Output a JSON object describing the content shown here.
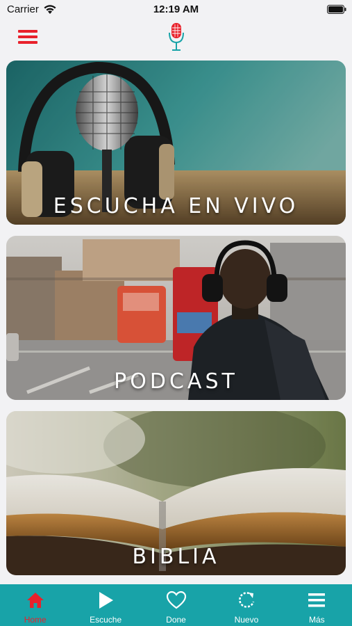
{
  "status_bar": {
    "carrier": "Carrier",
    "time": "12:19 AM"
  },
  "header": {
    "menu_icon": "hamburger-menu-icon",
    "logo_icon": "microphone-logo-icon",
    "accent_color": "#e8212b"
  },
  "cards": [
    {
      "label": "ESCUCHA EN VIVO",
      "image": "microphone-headphones-photo"
    },
    {
      "label": "PODCAST",
      "image": "man-with-headphones-street-photo"
    },
    {
      "label": "BIBLIA",
      "image": "open-bible-photo"
    }
  ],
  "tab_bar": {
    "background": "#18a3a8",
    "tabs": [
      {
        "label": "Home",
        "icon": "home-icon",
        "active": true
      },
      {
        "label": "Escuche",
        "icon": "play-icon",
        "active": false
      },
      {
        "label": "Done",
        "icon": "heart-icon",
        "active": false
      },
      {
        "label": "Nuevo",
        "icon": "refresh-icon",
        "active": false
      },
      {
        "label": "Más",
        "icon": "menu-icon",
        "active": false
      }
    ]
  }
}
